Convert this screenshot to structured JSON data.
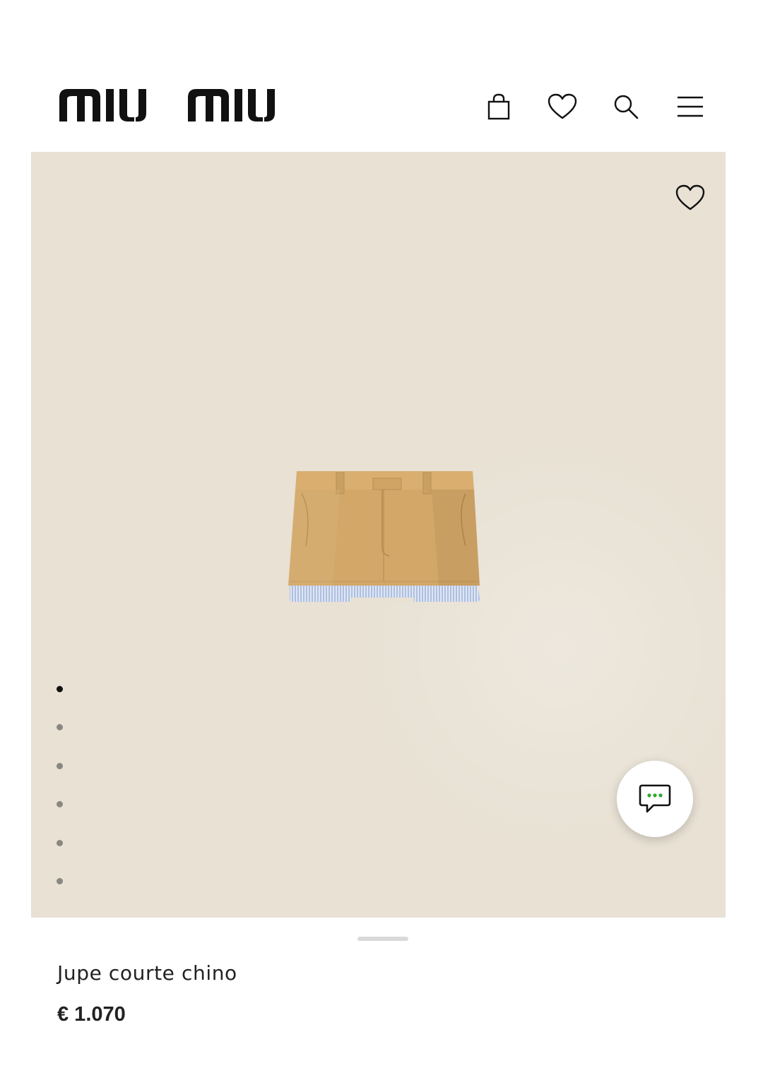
{
  "brand": {
    "logo_text": "miu miu"
  },
  "header": {
    "icons": [
      "shopping-bag-icon",
      "heart-icon",
      "search-icon",
      "menu-icon"
    ]
  },
  "gallery": {
    "image_alt": "Jupe courte chino",
    "slide_count": 6,
    "active_slide": 1,
    "background_color": "#e8e1d4"
  },
  "product": {
    "name": "Jupe courte chino",
    "price": "€ 1.070"
  },
  "chat": {
    "icon": "chat-bubble-icon",
    "accent_color": "#2eaa2e"
  }
}
